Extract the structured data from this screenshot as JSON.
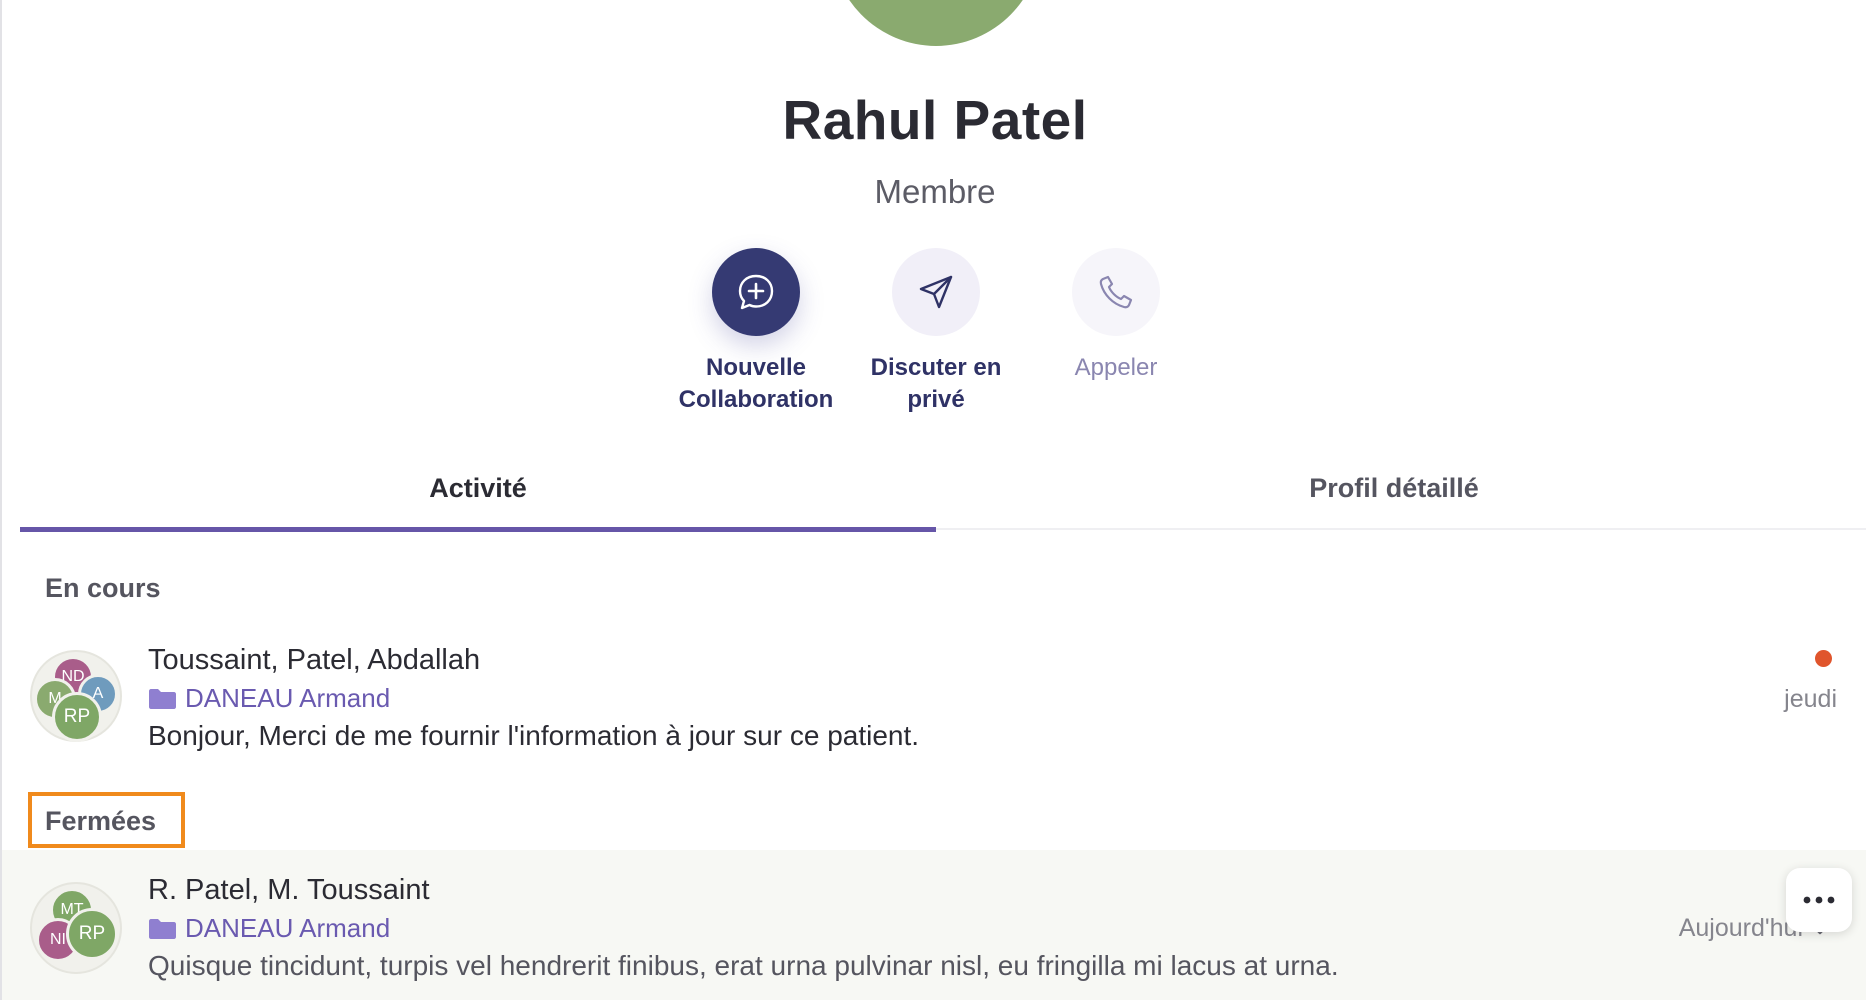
{
  "profile": {
    "name": "Rahul Patel",
    "role": "Membre"
  },
  "actions": [
    {
      "label_line1": "Nouvelle",
      "label_line2": "Collaboration",
      "icon": "chat-plus-icon"
    },
    {
      "label_line1": "Discuter en",
      "label_line2": "privé",
      "icon": "send-icon"
    },
    {
      "label_line1": "Appeler",
      "label_line2": "",
      "icon": "phone-icon"
    }
  ],
  "tabs": {
    "activity": "Activité",
    "profile": "Profil détaillé",
    "active": "activity"
  },
  "sections": {
    "current": "En cours",
    "closed": "Fermées"
  },
  "conversations": [
    {
      "title": "Toussaint, Patel, Abdallah",
      "case": "DANEAU Armand",
      "preview": "Bonjour, Merci de me fournir l'information à jour sur ce patient.",
      "time": "jeudi",
      "unread": true,
      "avatars": [
        {
          "initials": "ND",
          "color": "#a95d8a"
        },
        {
          "initials": "A",
          "color": "#6f9bbd"
        },
        {
          "initials": "M",
          "color": "#8aaa6f"
        },
        {
          "initials": "RP",
          "color": "#7fa766"
        }
      ]
    },
    {
      "title": "R. Patel, M. Toussaint",
      "case": "DANEAU Armand",
      "preview": "Quisque tincidunt, turpis vel hendrerit finibus, erat urna pulvinar nisl, eu fringilla mi lacus at urna.",
      "time": "Aujourd'hui",
      "unread": false,
      "avatars": [
        {
          "initials": "MT",
          "color": "#7fa766"
        },
        {
          "initials": "NI",
          "color": "#a95d8a"
        },
        {
          "initials": "RP",
          "color": "#7fa766"
        }
      ]
    }
  ],
  "colors": {
    "accent": "#6656a8",
    "primary_button": "#353a73",
    "unread": "#e0552c",
    "highlight_box": "#f08a1c",
    "avatar_large": "#8aaa6f"
  }
}
